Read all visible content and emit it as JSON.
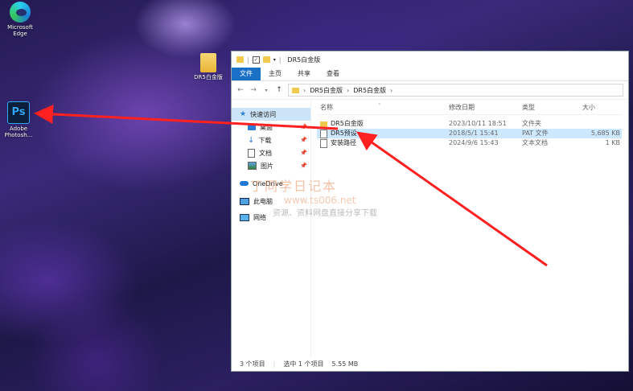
{
  "desktop": {
    "icons": [
      {
        "label_line1": "Microsoft",
        "label_line2": "Edge"
      },
      {
        "label_line1": "Adobe",
        "label_line2": "Photosh..."
      },
      {
        "label_line1": "DR5白金版",
        "label_line2": ""
      }
    ]
  },
  "window": {
    "title": "DR5白金版",
    "ribbon_tabs": [
      "文件",
      "主页",
      "共享",
      "查看"
    ],
    "address": [
      "DR5白金版",
      "DR5白金版"
    ],
    "nav": {
      "quick_access": "快速访问",
      "desktop": "桌面",
      "downloads": "下载",
      "documents": "文档",
      "pictures": "图片",
      "onedrive": "OneDrive",
      "this_pc": "此电脑",
      "network": "网络"
    },
    "columns": {
      "name": "名称",
      "date": "修改日期",
      "type": "类型",
      "size": "大小"
    },
    "files": [
      {
        "name": "DR5白金版",
        "date": "2023/10/11 18:51",
        "type": "文件夹",
        "size": ""
      },
      {
        "name": "DR5预设",
        "date": "2018/5/1 15:41",
        "type": "PAT 文件",
        "size": "5,685 KB"
      },
      {
        "name": "安装路径",
        "date": "2024/9/6 15:43",
        "type": "文本文档",
        "size": "1 KB"
      }
    ],
    "status": {
      "count": "3 个项目",
      "selected": "选中 1 个项目",
      "size": "5.55 MB"
    }
  },
  "watermark": {
    "title": "丁同学日记本",
    "url": "www.ts006.net",
    "subtitle": "资源、资料网盘直接分享下载"
  },
  "colors": {
    "accent": "#1a6fc6",
    "arrow": "#ff2020",
    "selection": "#cce8ff"
  }
}
